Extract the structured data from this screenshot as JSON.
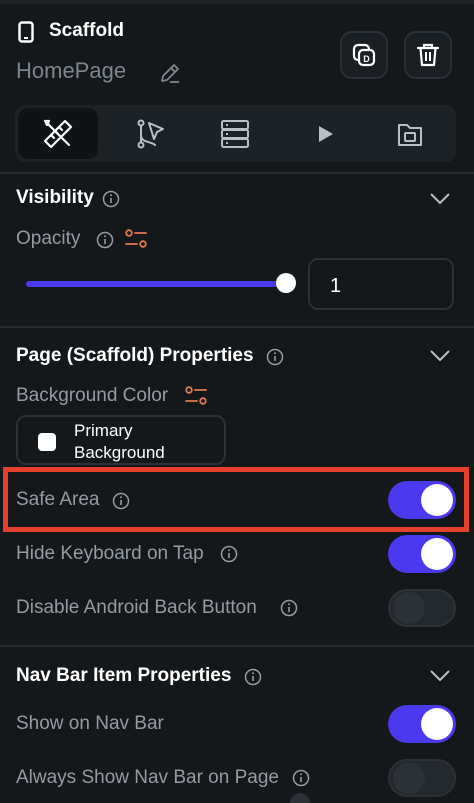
{
  "header": {
    "component_type": "Scaffold",
    "page_name": "HomePage",
    "icons": {
      "component": "phone-icon",
      "edit": "pencil-icon",
      "copy": "copy-icon",
      "delete": "trash-icon"
    }
  },
  "tabs": [
    {
      "name": "properties",
      "icon": "ruler-pencil-icon",
      "active": true
    },
    {
      "name": "actions",
      "icon": "cursor-flow-icon",
      "active": false
    },
    {
      "name": "backend",
      "icon": "database-icon",
      "active": false
    },
    {
      "name": "animations",
      "icon": "play-icon",
      "active": false
    },
    {
      "name": "page-settings",
      "icon": "folder-page-icon",
      "active": false
    }
  ],
  "visibility": {
    "title": "Visibility",
    "opacity_label": "Opacity",
    "opacity_value": "1",
    "slider_fraction": 1.0
  },
  "page_props": {
    "title": "Page (Scaffold) Properties",
    "background_label": "Background Color",
    "background_value": "Primary Background",
    "safe_area_label": "Safe Area",
    "safe_area_on": true,
    "hide_keyboard_label": "Hide Keyboard on Tap",
    "hide_keyboard_on": true,
    "disable_back_label": "Disable Android Back Button",
    "disable_back_on": false
  },
  "nav_props": {
    "title": "Nav Bar Item Properties",
    "show_label": "Show on Nav Bar",
    "show_on": true,
    "always_show_label": "Always Show Nav Bar on Page",
    "always_show_on": false
  },
  "colors": {
    "accent": "#4b39ef",
    "highlight": "#e5402d",
    "background": "#14181b",
    "label": "#949ba3",
    "variable_icon": "#e07a4f"
  }
}
